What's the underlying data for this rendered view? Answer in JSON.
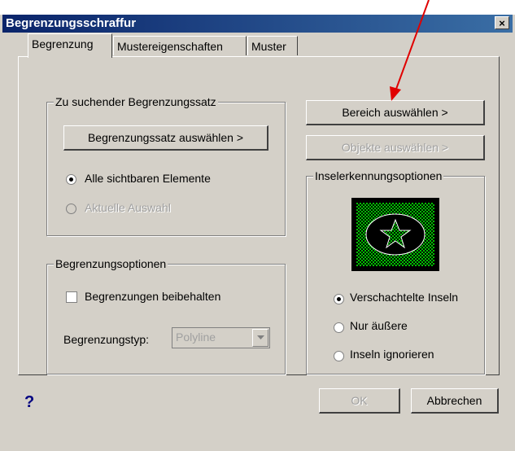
{
  "window": {
    "title": "Begrenzungsschraffur",
    "close_label": "×"
  },
  "tabs": [
    {
      "label": "Begrenzung",
      "active": true
    },
    {
      "label": "Mustereigenschaften",
      "active": false
    },
    {
      "label": "Muster",
      "active": false
    }
  ],
  "boundary_set": {
    "legend": "Zu suchender Begrenzungssatz",
    "select_button": "Begrenzungssatz auswählen >",
    "options": [
      {
        "label": "Alle sichtbaren Elemente",
        "checked": true,
        "enabled": true
      },
      {
        "label": "Aktuelle Auswahl",
        "checked": false,
        "enabled": false
      }
    ]
  },
  "boundary_options": {
    "legend": "Begrenzungsoptionen",
    "keep_label": "Begrenzungen beibehalten",
    "keep_checked": false,
    "type_label": "Begrenzungstyp:",
    "type_value": "Polyline"
  },
  "actions": {
    "pick_area": "Bereich auswählen >",
    "pick_objects": "Objekte auswählen >"
  },
  "island_detection": {
    "legend": "Inselerkennungsoptionen",
    "options": [
      {
        "label": "Verschachtelte Inseln",
        "checked": true
      },
      {
        "label": "Nur äußere",
        "checked": false
      },
      {
        "label": "Inseln ignorieren",
        "checked": false
      }
    ]
  },
  "footer": {
    "help": "?",
    "ok": "OK",
    "cancel": "Abbrechen"
  },
  "colors": {
    "titlebar": "#0a246a",
    "face": "#d4d0c8",
    "preview_green": "#00c000",
    "annotation_arrow": "#e00000"
  }
}
